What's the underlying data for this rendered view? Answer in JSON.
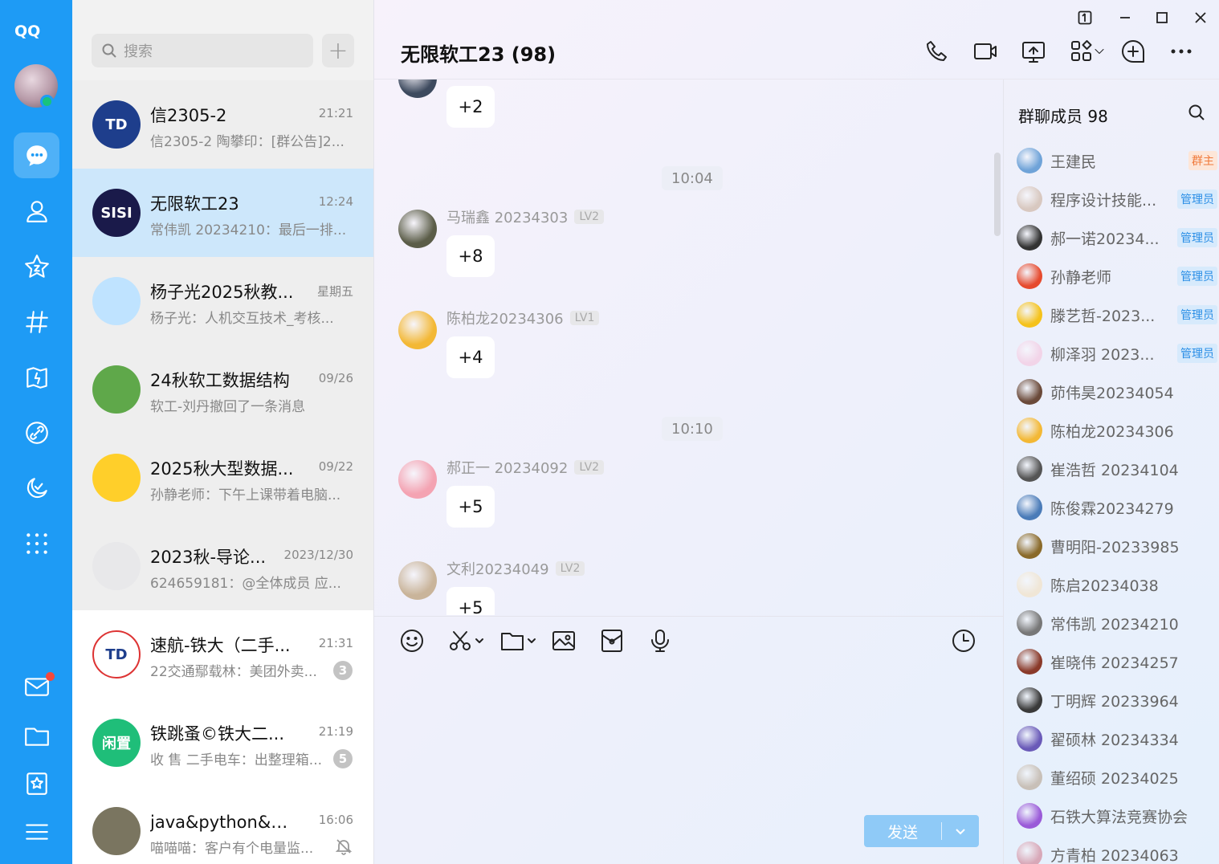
{
  "nav": {
    "logo": "QQ",
    "icons": [
      "message-icon",
      "contacts-icon",
      "star-icon",
      "channel-icon",
      "game-icon",
      "link-icon",
      "moon-icon",
      "apps-icon",
      "mail-icon",
      "folder-icon",
      "favorites-icon",
      "menu-icon"
    ],
    "accent": "#1e9bf5"
  },
  "list": {
    "search_placeholder": "搜索",
    "add_label": "+",
    "conversations": [
      {
        "name": "信2305-2",
        "time": "21:21",
        "preview": "信2305-2 陶攀印：[群公告]2...",
        "avatar": "TD",
        "avatar_color": "#1e3e8c"
      },
      {
        "name": "无限软工23",
        "time": "12:24",
        "preview": "常伟凯 20234210：最后一排...",
        "avatar": "SISI",
        "avatar_color": "#1a1a4a"
      },
      {
        "name": "杨子光2025秋教...",
        "time": "星期五",
        "preview": "杨子光：人机交互技术_考核...",
        "avatar": "",
        "avatar_color": "#bfe3ff"
      },
      {
        "name": "24秋软工数据结构",
        "time": "09/26",
        "preview": "软工-刘丹撤回了一条消息",
        "avatar": "",
        "avatar_color": "#5fa84a"
      },
      {
        "name": "2025秋大型数据...",
        "time": "09/22",
        "preview": "孙静老师：下午上课带着电脑...",
        "avatar": "",
        "avatar_color": "#ffcf2a"
      },
      {
        "name": "2023秋-导论...",
        "time": "2023/12/30",
        "preview": "624659181：@全体成员 应...",
        "avatar": "",
        "avatar_color": "#e8e8ea"
      },
      {
        "name": "速航-铁大（二手...",
        "time": "21:31",
        "preview": "22交通鄢载林：美团外卖...",
        "avatar": "TD",
        "avatar_color": "#ffffff",
        "badge": "3"
      },
      {
        "name": "铁跳蚤©铁大二...",
        "time": "21:19",
        "preview": "收 售 二手电车：出整理箱...",
        "avatar": "闲置",
        "avatar_color": "#1fbe79",
        "badge": "5"
      },
      {
        "name": "java&python&互...",
        "time": "16:06",
        "preview": "喵喵喵：客户有个电量监...",
        "avatar": "",
        "avatar_color": "#7a7560",
        "muted": true
      }
    ]
  },
  "chat": {
    "title": "无限软工23 (98)",
    "messages": [
      {
        "type": "bubble",
        "text": "+2",
        "avatar_color": "#3d4a5e"
      },
      {
        "type": "time",
        "text": "10:04"
      },
      {
        "type": "msg",
        "sender": "马瑞鑫 20234303",
        "level": "LV2",
        "text": "+8",
        "avatar_color": "#5b5d48"
      },
      {
        "type": "msg",
        "sender": "陈柏龙20234306",
        "level": "LV1",
        "text": "+4",
        "avatar_color": "#f3b835"
      },
      {
        "type": "time",
        "text": "10:10"
      },
      {
        "type": "msg",
        "sender": "郝正一 20234092",
        "level": "LV2",
        "text": "+5",
        "avatar_color": "#f4a3b2"
      },
      {
        "type": "msg",
        "sender": "文利20234049",
        "level": "LV2",
        "text": "+5",
        "avatar_color": "#c9b49a"
      }
    ],
    "send_label": "发送"
  },
  "members": {
    "title": "群聊成员 98",
    "list": [
      {
        "name": "王建民",
        "tag": "群主",
        "color": "#6fa3d8"
      },
      {
        "name": "程序设计技能...",
        "tag": "管理员",
        "color": "#d8c8c0"
      },
      {
        "name": "郝一诺20234...",
        "tag": "管理员",
        "color": "#333333"
      },
      {
        "name": "孙静老师",
        "tag": "管理员",
        "color": "#e64a2e"
      },
      {
        "name": "滕艺哲-2023...",
        "tag": "管理员",
        "color": "#f5c21b"
      },
      {
        "name": "柳泽羽 2023...",
        "tag": "管理员",
        "color": "#f2d4e8"
      },
      {
        "name": "茆伟昊20234054",
        "tag": "",
        "color": "#6b4a3a"
      },
      {
        "name": "陈柏龙20234306",
        "tag": "",
        "color": "#f3b835"
      },
      {
        "name": "崔浩哲 20234104",
        "tag": "",
        "color": "#555555"
      },
      {
        "name": "陈俊霖20234279",
        "tag": "",
        "color": "#4a7bb8"
      },
      {
        "name": "曹明阳-20233985",
        "tag": "",
        "color": "#8a6a2a"
      },
      {
        "name": "陈启20234038",
        "tag": "",
        "color": "#f0e6d6"
      },
      {
        "name": "常伟凯 20234210",
        "tag": "",
        "color": "#777777"
      },
      {
        "name": "崔晓伟 20234257",
        "tag": "",
        "color": "#8a3a2a"
      },
      {
        "name": "丁明辉 20233964",
        "tag": "",
        "color": "#3a3a3a"
      },
      {
        "name": "翟硕林 20234334",
        "tag": "",
        "color": "#6a5ab8"
      },
      {
        "name": "董绍硕 20234025",
        "tag": "",
        "color": "#c8c0b8"
      },
      {
        "name": "石铁大算法竞赛协会",
        "tag": "",
        "color": "#9a5ad8"
      },
      {
        "name": "方青柏 20234063",
        "tag": "",
        "color": "#d8a8b8"
      }
    ]
  }
}
